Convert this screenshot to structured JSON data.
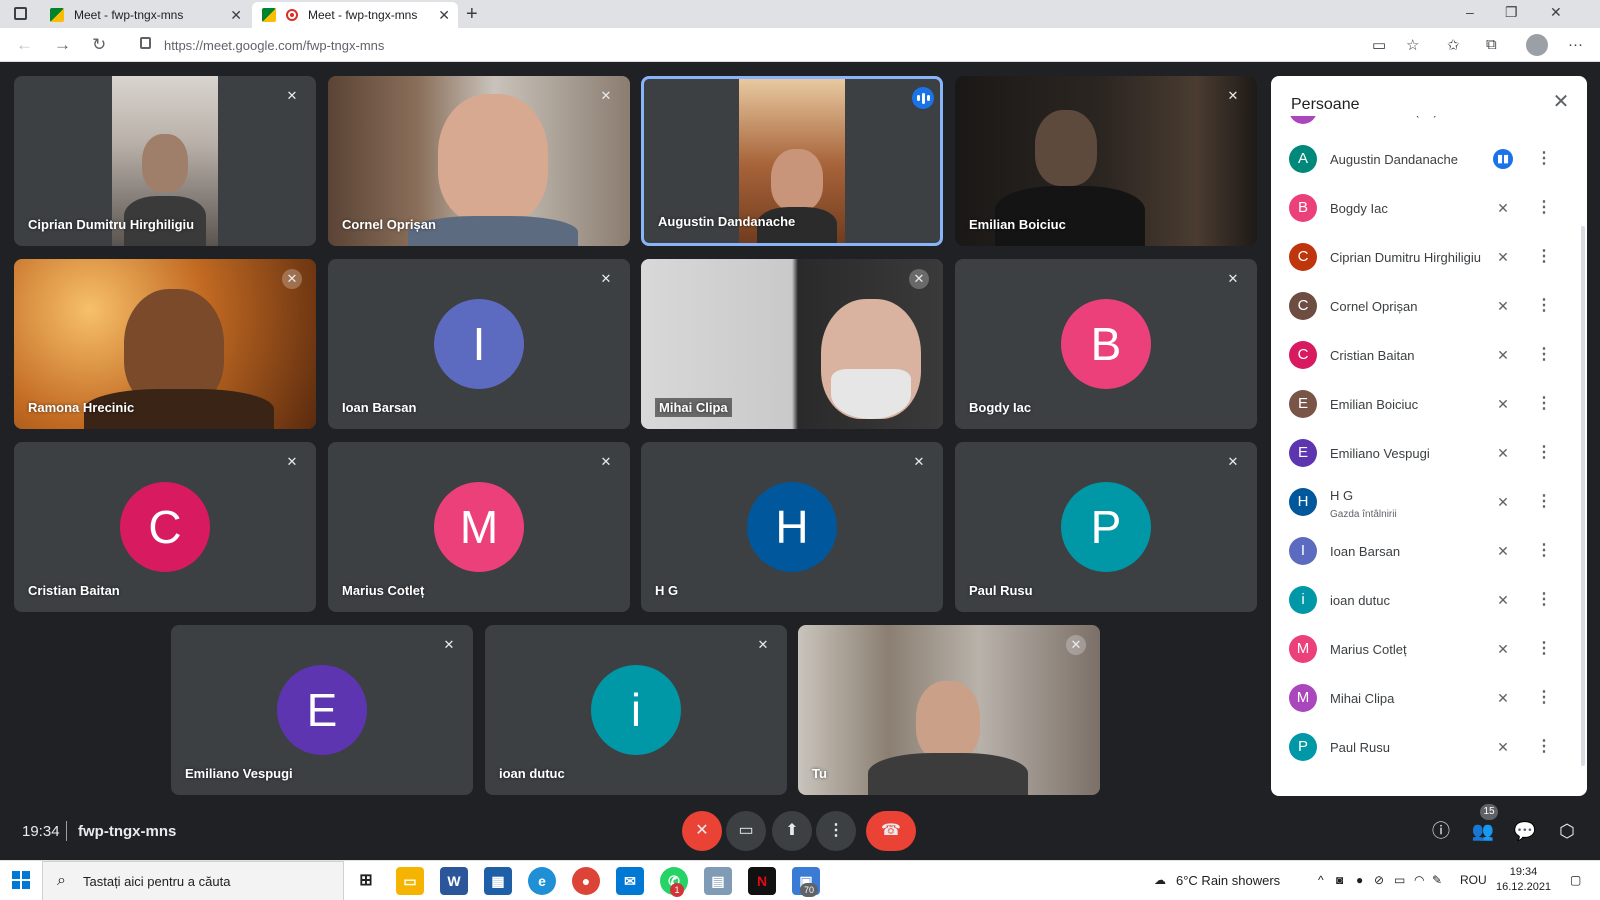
{
  "browser": {
    "tabs": [
      {
        "title": "Meet - fwp-tngx-mns",
        "active": false
      },
      {
        "title": "Meet - fwp-tngx-mns",
        "active": true
      }
    ],
    "new_tab": "+",
    "url": "https://meet.google.com/fwp-tngx-mns",
    "window_controls": {
      "minimize": "–",
      "maximize": "❐",
      "close": "✕"
    }
  },
  "tiles": [
    {
      "name": "Ciprian Dumitru Hirghiligiu",
      "type": "video",
      "muted": true
    },
    {
      "name": "Cornel Oprișan",
      "type": "video",
      "muted": true
    },
    {
      "name": "Augustin Dandanache",
      "type": "video",
      "speaking": true
    },
    {
      "name": "Emilian Boiciuc",
      "type": "video",
      "muted": true
    },
    {
      "name": "Ramona Hrecinic",
      "type": "video",
      "muted": true
    },
    {
      "name": "Ioan Barsan",
      "type": "avatar",
      "initial": "I",
      "color": "#5c6bc0",
      "muted": true
    },
    {
      "name": "Mihai Clipa",
      "type": "video",
      "muted": true
    },
    {
      "name": "Bogdy Iac",
      "type": "avatar",
      "initial": "B",
      "color": "#ec407a",
      "muted": true
    },
    {
      "name": "Cristian Baitan",
      "type": "avatar",
      "initial": "C",
      "color": "#d81b60",
      "muted": true
    },
    {
      "name": "Marius Cotleț",
      "type": "avatar",
      "initial": "M",
      "color": "#ec407a",
      "muted": true
    },
    {
      "name": "H G",
      "type": "avatar",
      "initial": "H",
      "color": "#01579b",
      "muted": true
    },
    {
      "name": "Paul Rusu",
      "type": "avatar",
      "initial": "P",
      "color": "#0097a7",
      "muted": true
    },
    {
      "name": "Emiliano Vespugi",
      "type": "avatar",
      "initial": "E",
      "color": "#5e35b1",
      "muted": true
    },
    {
      "name": "ioan dutuc",
      "type": "avatar",
      "initial": "i",
      "color": "#0097a7",
      "muted": true
    },
    {
      "name": "Tu",
      "type": "video",
      "muted": true
    }
  ],
  "people_panel": {
    "title": "Persoane",
    "people": [
      {
        "name": "Iustin Croitoru (Tu)",
        "initial": "I",
        "color": "#ab47bc",
        "status": "muted"
      },
      {
        "name": "Augustin Dandanache",
        "initial": "A",
        "color": "#00897b",
        "status": "speaking"
      },
      {
        "name": "Bogdy Iac",
        "initial": "B",
        "color": "#ec407a",
        "status": "muted"
      },
      {
        "name": "Ciprian Dumitru Hirghiligiu",
        "initial": "C",
        "color": "#bf360c",
        "status": "muted"
      },
      {
        "name": "Cornel Oprișan",
        "initial": "C",
        "color": "#6d4c41",
        "status": "muted"
      },
      {
        "name": "Cristian Baitan",
        "initial": "C",
        "color": "#d81b60",
        "status": "muted"
      },
      {
        "name": "Emilian Boiciuc",
        "initial": "E",
        "color": "#795548",
        "status": "muted"
      },
      {
        "name": "Emiliano Vespugi",
        "initial": "E",
        "color": "#5e35b1",
        "status": "muted"
      },
      {
        "name": "H G",
        "initial": "H",
        "color": "#01579b",
        "status": "muted",
        "subtitle": "Gazda întâlnirii"
      },
      {
        "name": "Ioan Barsan",
        "initial": "I",
        "color": "#5c6bc0",
        "status": "muted"
      },
      {
        "name": "ioan dutuc",
        "initial": "i",
        "color": "#0097a7",
        "status": "muted"
      },
      {
        "name": "Marius Cotleț",
        "initial": "M",
        "color": "#ec407a",
        "status": "muted"
      },
      {
        "name": "Mihai Clipa",
        "initial": "M",
        "color": "#ab47bc",
        "status": "muted"
      },
      {
        "name": "Paul Rusu",
        "initial": "P",
        "color": "#0097a7",
        "status": "muted"
      }
    ]
  },
  "meeting_bar": {
    "time": "19:34",
    "code": "fwp-tngx-mns",
    "people_count": "15"
  },
  "taskbar": {
    "search_placeholder": "Tastați aici pentru a căuta",
    "weather": "6°C  Rain showers",
    "language": "ROU",
    "time": "19:34",
    "date": "16.12.2021",
    "mail_badge": "1",
    "files_badge": "70"
  }
}
